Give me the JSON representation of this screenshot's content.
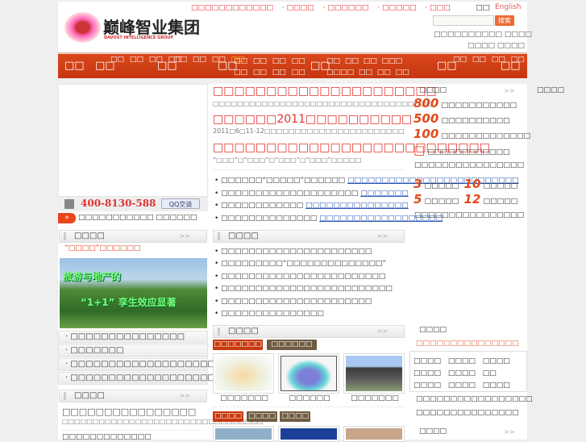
{
  "header": {
    "top_links": [
      "□□□□□□□□□□□□",
      "□□□□",
      "□□□□□□",
      "□□□□□",
      "□□□"
    ],
    "lang_cn": "□□",
    "lang_en": "English",
    "logo_text": "巅峰智业集团",
    "logo_subtext": "DAVOST INTELLIGENCE GROUP",
    "search_placeholder": "",
    "search_button": "搜索",
    "info1": "□□□□□□□□□□ □□□□",
    "info2": "□□□□ □□□□"
  },
  "nav": {
    "items": [
      {
        "label": "□□",
        "subs": []
      },
      {
        "label": "□□",
        "subs": [
          "□□",
          "□□",
          "□□",
          "□□"
        ]
      },
      {
        "label": "□□",
        "subs": [
          "□□",
          "□□",
          "□□",
          "□□"
        ]
      },
      {
        "label": "□□",
        "subs": [
          "□□",
          "□□",
          "□□",
          "□□",
          "□□",
          "□□",
          "□□",
          "□□"
        ]
      },
      {
        "label": "□□",
        "subs": [
          "□□",
          "□□",
          "□□",
          "□□□",
          "□□□□",
          "□□",
          "□□",
          "□□",
          "□□□",
          "□□□□"
        ]
      },
      {
        "label": "□□",
        "subs": [
          "□□",
          "□□",
          "□□",
          "□□"
        ]
      },
      {
        "label": "□□",
        "subs": []
      }
    ]
  },
  "left": {
    "phone": "400-8130-588",
    "qq": "QQ交谈",
    "ticker": "□□□□□□□□□□□ □□□□□□",
    "section1": "□□□□",
    "section1_more": ">>",
    "featured": "“□□□□”□□□□□□",
    "banner_text1": "旅游与地产的",
    "banner_text2": "“1+1”  孪生效应显著",
    "list": [
      "□□□□□□□□□□□□□□□",
      "□□□□□□□",
      "□□□□□□□□□□□□□□□□□□□□",
      "□□□□□□□□□□□□□□□□□□□□"
    ],
    "section2": "□□□□",
    "section2_more": ">>",
    "s2_title": "□□□□□□□□□□□□□□□□",
    "s2_desc": "□□□□□□□□□□□□□□□□□□□□□□□□□□□□□□□□□",
    "s2_item": "□□□□□□□□□□□□□"
  },
  "middle": {
    "headlines": [
      {
        "title": "□□□□□□□□□□□□□□□□□□□□□",
        "desc": "□□□□□□□□□□□□□□□□□□□□□□□□□□□□□□□□□□□□"
      },
      {
        "title": "□□□□□□2011□□□□□□□□□□",
        "desc": "2011□6□11-12□□□□□□□□□□□□□□□□□□□□□□□"
      },
      {
        "title": "□□□□□□□□□□□□□□□□□□□□□□□□□□",
        "desc": "“□□□”□“□□□”□“□□□”□“□□□”□□□□□"
      }
    ],
    "bullets": [
      {
        "text": "□□□□□□“□□□□□”□□□□□□",
        "link": "□□□□□□□□□□□□□□□□□□□□□□□□□"
      },
      {
        "text": "□□□□□□□□□□□□□□□□□□□□",
        "link": "□□□□□□□"
      },
      {
        "text": "□□□□□□□□□□□□",
        "link": "□□□□□□□□□□□□□□□"
      },
      {
        "text": "□□□□□□□□□□□□□□",
        "link": "□□□□□□□□□□□□□□□□□□"
      }
    ],
    "section1": "□□□□",
    "section1_more": ">>",
    "section1_items": [
      "□□□□□□□□□□□□□□□□□□□□□□",
      "□□□□□□□□□“□□□□□□□□□□□□□□”",
      "□□□□□□□□□□□□□□□□□□□□□□□□",
      "□□□□□□□□□□□□□□□□□□□□□□□□□",
      "□□□□□□□□□□□□□□□□□□□□□□",
      "□□□□□□□□□□□□□□□"
    ],
    "section2": "□□□□",
    "section2_more": ">>",
    "tabs1": [
      "□□□□□□□",
      "□□□□□□"
    ],
    "thumbs": [
      "□□□□□□□",
      "□□□□□□",
      "□□□□□□□"
    ],
    "tabs2": [
      "□□□□",
      "□□□□",
      "□□□□"
    ]
  },
  "right": {
    "section1": "□□□□",
    "section1_more": ">>",
    "stats": [
      {
        "num": "800",
        "text": "□□□□□□□□□□□"
      },
      {
        "num": "500",
        "text": "□□□□□□□□□□"
      },
      {
        "num": "100",
        "text": "□□□□□□□□□□□□□"
      },
      {
        "num": "□",
        "text": "□□□□□□□□□□□□"
      }
    ],
    "stats_line": "□□□□□□□□□□□□□□□□",
    "pairs": [
      {
        "n1": "3",
        "t1": "□□□□□",
        "n2": "10",
        "t2": "□□□□□"
      },
      {
        "n1": "5",
        "t1": "□□□□□",
        "n2": "12",
        "t2": "□□□□□"
      }
    ],
    "pairs_line": "□□□□□□□□□□□□□□□□",
    "section2": "□□□□",
    "section2_red": "□□□□□□□□□□□□□□□",
    "tags": [
      "□□□□",
      "□□□□",
      "□□□□",
      "□□□□",
      "□□□□",
      "□□",
      "□□□□",
      "□□□□",
      "□□□□"
    ],
    "lines": [
      "□□□□□□□□□□□□□□□□□",
      "□□□□□□□□□□□□□□□"
    ],
    "section3": "□□□□",
    "section3_more": ">>"
  },
  "far_right": {
    "label": "□□□□"
  }
}
